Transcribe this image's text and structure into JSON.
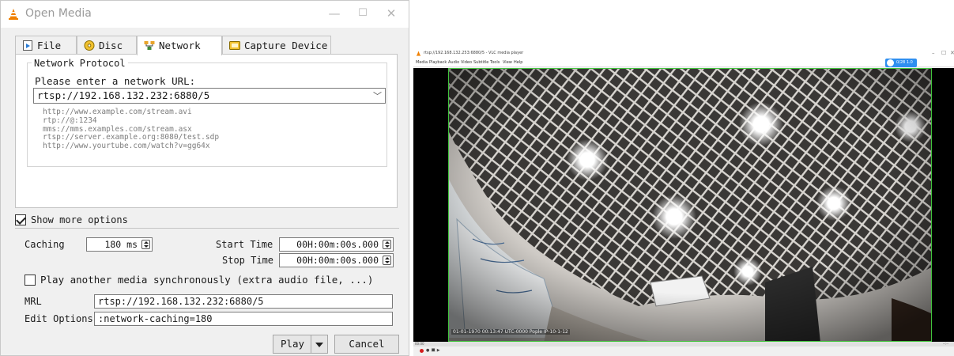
{
  "dialog": {
    "title": "Open Media",
    "window_buttons": {
      "minimize": "—",
      "maximize": "☐",
      "close": "✕"
    },
    "tabs": [
      {
        "label": "File"
      },
      {
        "label": "Disc"
      },
      {
        "label": "Network",
        "active": true
      },
      {
        "label": "Capture Device"
      }
    ],
    "network": {
      "group_label": "Network Protocol",
      "url_prompt": "Please enter a network URL:",
      "url_value": "rtsp://192.168.132.232:6880/5",
      "examples": [
        "http://www.example.com/stream.avi",
        "rtp://@:1234",
        "mms://mms.examples.com/stream.asx",
        "rtsp://server.example.org:8080/test.sdp",
        "http://www.yourtube.com/watch?v=gg64x"
      ]
    },
    "show_more_options": {
      "label": "Show more options",
      "checked": true
    },
    "caching": {
      "label": "Caching",
      "value": "180 ms"
    },
    "start_time": {
      "label": "Start Time",
      "value": "00H:00m:00s.000"
    },
    "stop_time": {
      "label": "Stop Time",
      "value": "00H:00m:00s.000"
    },
    "play_another": {
      "label": "Play another media synchronously (extra audio file, ...)",
      "checked": false
    },
    "mrl": {
      "label": "MRL",
      "value": "rtsp://192.168.132.232:6880/5"
    },
    "edit_options": {
      "label": "Edit Options",
      "value": ":network-caching=180"
    },
    "buttons": {
      "play": "Play",
      "cancel": "Cancel"
    }
  },
  "player": {
    "title": "rtsp://192.168.132.253:6880/5 - VLC media player",
    "menu": [
      "Media",
      "Playback",
      "Audio",
      "Video",
      "Subtitle",
      "Tools",
      "View",
      "Help"
    ],
    "badge": "0/28 1.0",
    "osd_text": "01-01-1970 00:13:47 UTC-0000 Pople IP-10-1-12",
    "elapsed": "00:00",
    "remaining": "--:--",
    "controls_text": "● 🔳 ▶"
  },
  "colors": {
    "vlc_orange": "#f08000",
    "video_border": "#41c43c",
    "badge_blue": "#2f8ff0"
  }
}
